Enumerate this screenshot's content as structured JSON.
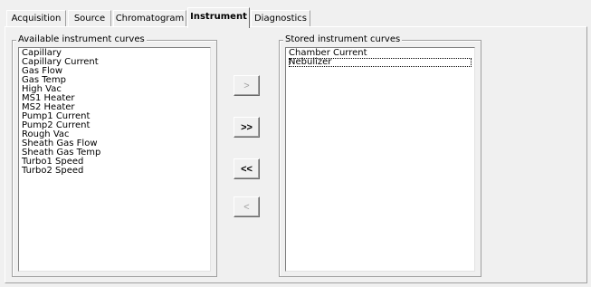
{
  "tabs": [
    "Acquisition",
    "Source",
    "Chromatogram",
    "Instrument",
    "Diagnostics"
  ],
  "active_tab": "Instrument",
  "available": {
    "label": "Available instrument curves",
    "items": [
      "Capillary",
      "Capillary Current",
      "Gas Flow",
      "Gas Temp",
      "High Vac",
      "MS1 Heater",
      "MS2 Heater",
      "Pump1 Current",
      "Pump2 Current",
      "Rough Vac",
      "Sheath Gas Flow",
      "Sheath Gas Temp",
      "Turbo1 Speed",
      "Turbo2 Speed"
    ]
  },
  "stored": {
    "label": "Stored instrument curves",
    "items": [
      "Chamber Current",
      "Nebulizer"
    ],
    "focused_item": "Nebulizer"
  },
  "buttons": {
    "add": ">",
    "add_all": ">>",
    "remove_all": "<<",
    "remove": "<"
  }
}
